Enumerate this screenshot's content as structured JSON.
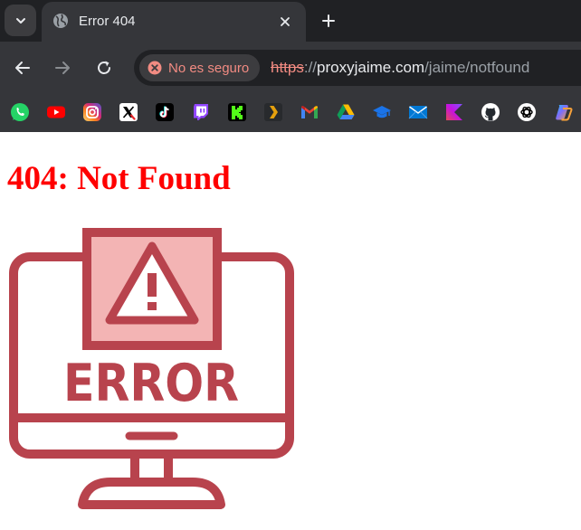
{
  "browser": {
    "tab": {
      "title": "Error 404"
    },
    "omnibox": {
      "security_label": "No es seguro",
      "url_scheme": "https",
      "url_separator": "://",
      "url_host": "proxyjaime.com",
      "url_path": "/jaime/notfound"
    },
    "bookmarks": [
      {
        "icon": "whatsapp-icon",
        "color": "#25d366"
      },
      {
        "icon": "youtube-icon",
        "color": "#ff0000"
      },
      {
        "icon": "instagram-icon",
        "color": "#e1306c"
      },
      {
        "icon": "x-icon",
        "color": "#ffffff"
      },
      {
        "icon": "tiktok-icon",
        "color": "#000000"
      },
      {
        "icon": "twitch-icon",
        "color": "#9146ff"
      },
      {
        "icon": "kick-icon",
        "color": "#53fc18"
      },
      {
        "icon": "plex-icon",
        "color": "#e5a00d"
      },
      {
        "icon": "gmail-icon",
        "color": "#ea4335"
      },
      {
        "icon": "google-drive-icon",
        "color": "#0f9d58"
      },
      {
        "icon": "graduation-cap-icon",
        "color": "#1a73e8"
      },
      {
        "icon": "mail-icon",
        "color": "#0078d4"
      },
      {
        "icon": "kotlin-icon",
        "color": "#7f52ff"
      },
      {
        "icon": "github-icon",
        "color": "#ffffff"
      },
      {
        "icon": "chatgpt-icon",
        "color": "#ffffff"
      },
      {
        "icon": "copilot-icon",
        "color": "#7b6cff"
      }
    ]
  },
  "page": {
    "heading": "404: Not Found",
    "image": {
      "icon": "monitor-error-icon",
      "text": "ERROR",
      "colors": {
        "stroke": "#b8434d",
        "fill_light": "#f3b4b4",
        "background": "#ffffff"
      }
    }
  }
}
